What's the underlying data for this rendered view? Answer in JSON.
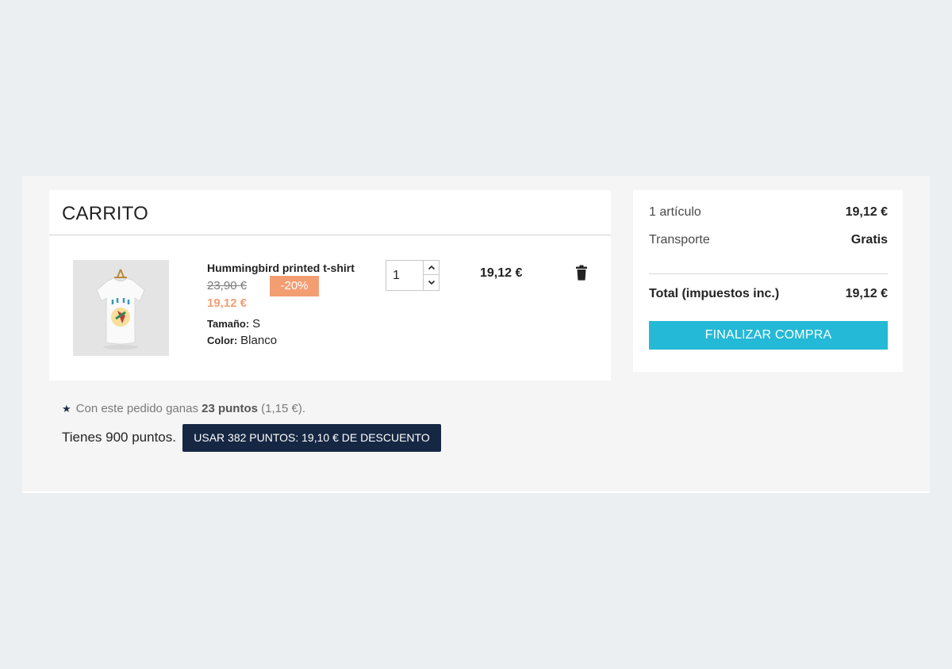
{
  "cart": {
    "title": "CARRITO",
    "item": {
      "name": "Hummingbird printed t-shirt",
      "old_price": "23,90 €",
      "discount": "-20%",
      "new_price": "19,12 €",
      "size_label": "Tamaño:",
      "size_value": "S",
      "color_label": "Color:",
      "color_value": "Blanco",
      "quantity": "1",
      "line_total": "19,12 €"
    }
  },
  "summary": {
    "items_label": "1 artículo",
    "items_value": "19,12 €",
    "shipping_label": "Transporte",
    "shipping_value": "Gratis",
    "total_label": "Total (impuestos inc.)",
    "total_value": "19,12 €",
    "checkout_label": "FINALIZAR COMPRA"
  },
  "loyalty": {
    "earn_prefix": "Con este pedido ganas",
    "earn_points": "23 puntos",
    "earn_value": "(1,15 €).",
    "have_points": "Tienes 900 puntos.",
    "use_button": "USAR 382 PUNTOS: 19,10 € DE DESCUENTO"
  },
  "colors": {
    "accent": "#24b9d7",
    "discount": "#f39d72",
    "dark_button": "#162743"
  }
}
